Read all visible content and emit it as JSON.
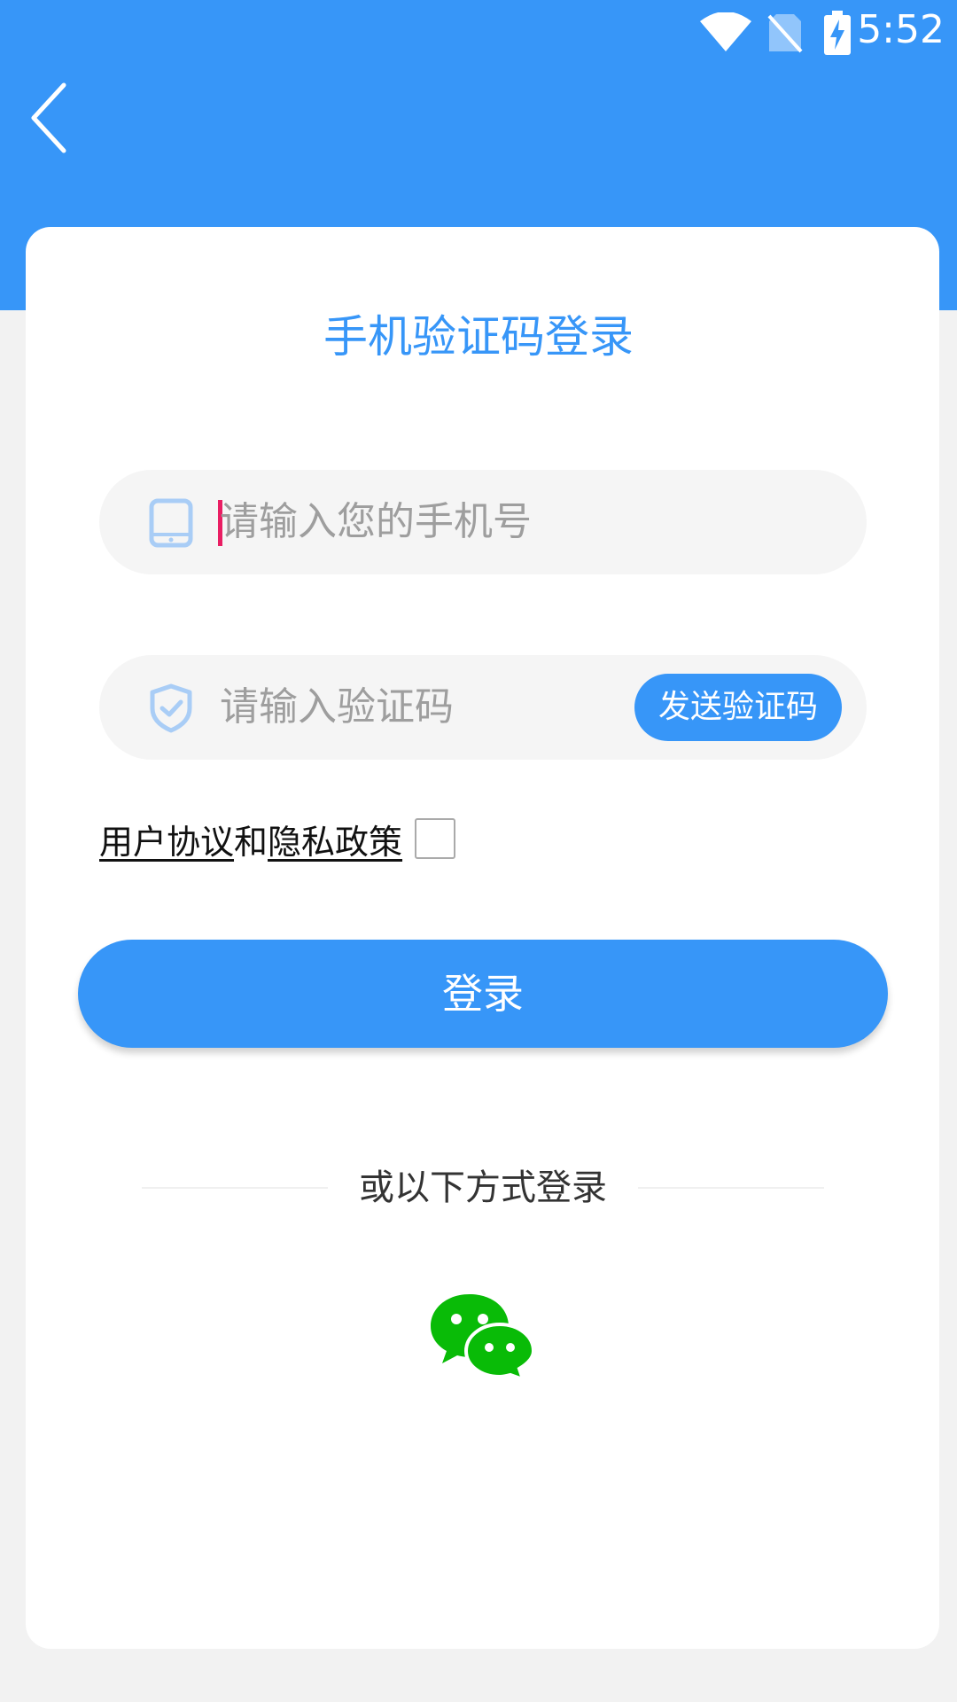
{
  "status_bar": {
    "time": "5:52",
    "icons": [
      "wifi-icon",
      "no-sim-icon",
      "battery-charging-icon"
    ]
  },
  "nav": {
    "back_icon": "chevron-left-icon"
  },
  "title": "手机验证码登录",
  "phone_field": {
    "placeholder": "请输入您的手机号",
    "icon": "phone-icon"
  },
  "code_field": {
    "placeholder": "请输入验证码",
    "icon": "shield-check-icon",
    "send_button": "发送验证码"
  },
  "agreement": {
    "user_agreement": "用户协议",
    "conjunction": "和",
    "privacy_policy": "隐私政策",
    "checked": false
  },
  "login_button": "登录",
  "alt_login": {
    "label": "或以下方式登录",
    "options": [
      "wechat-icon"
    ]
  },
  "colors": {
    "primary": "#3796f8",
    "wechat": "#09bb07"
  }
}
